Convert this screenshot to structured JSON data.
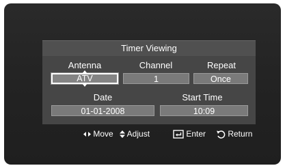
{
  "dialog": {
    "title": "Timer Viewing",
    "antenna": {
      "label": "Antenna",
      "value": "ATV"
    },
    "channel": {
      "label": "Channel",
      "value": "1"
    },
    "repeat": {
      "label": "Repeat",
      "value": "Once"
    },
    "date": {
      "label": "Date",
      "value": "01-01-2008"
    },
    "start_time": {
      "label": "Start Time",
      "value": "10:09"
    }
  },
  "help": {
    "move": {
      "icon": "left-right-arrows-icon",
      "label": "Move"
    },
    "adjust": {
      "icon": "up-down-arrows-icon",
      "label": "Adjust"
    },
    "enter": {
      "icon": "enter-icon",
      "label": "Enter"
    },
    "return": {
      "icon": "return-icon",
      "label": "Return"
    }
  },
  "colors": {
    "frame": "#232323",
    "title_bar": "#505050",
    "panel": "#464646",
    "field": "#7a7a7a",
    "text": "#ffffff"
  }
}
